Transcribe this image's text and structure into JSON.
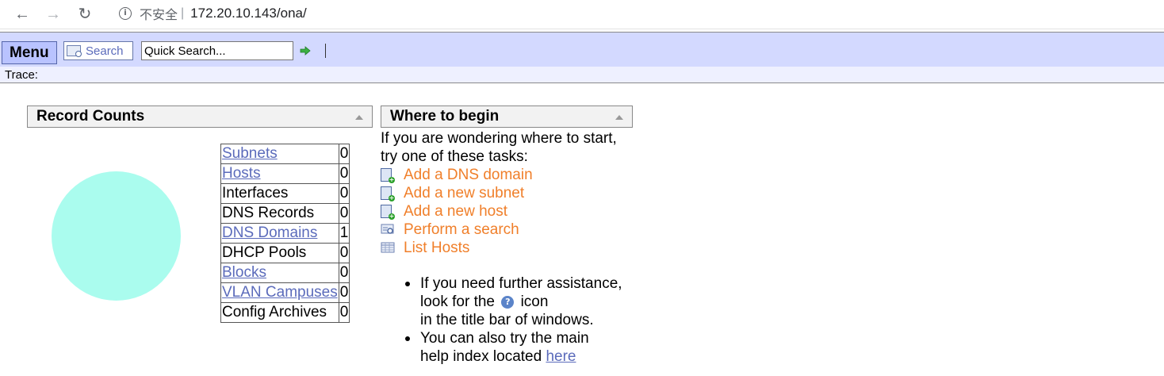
{
  "browser": {
    "back_icon": "arrow-left-icon",
    "forward_icon": "arrow-right-icon",
    "reload_icon": "reload-icon",
    "security_label": "不安全",
    "url": "172.20.10.143/ona/"
  },
  "toolbar": {
    "menu_label": "Menu",
    "search_label": "Search",
    "quick_search_value": "Quick Search...",
    "trace_label": "Trace:"
  },
  "record_counts": {
    "title": "Record Counts",
    "rows": [
      {
        "label": "Subnets",
        "count": "0",
        "link": true
      },
      {
        "label": "Hosts",
        "count": "0",
        "link": true
      },
      {
        "label": "Interfaces",
        "count": "0",
        "link": false
      },
      {
        "label": "DNS Records",
        "count": "0",
        "link": false
      },
      {
        "label": "DNS Domains",
        "count": "1",
        "link": true
      },
      {
        "label": "DHCP Pools",
        "count": "0",
        "link": false
      },
      {
        "label": "Blocks",
        "count": "0",
        "link": true
      },
      {
        "label": "VLAN Campuses",
        "count": "0",
        "link": true
      },
      {
        "label": "Config Archives",
        "count": "0",
        "link": false
      }
    ],
    "pie_color": "#aafcee"
  },
  "where_to_begin": {
    "title": "Where to begin",
    "intro_line1": "If you are wondering where to start,",
    "intro_line2": "try one of these tasks:",
    "tasks": [
      {
        "label": "Add a DNS domain",
        "icon": "add-document-icon"
      },
      {
        "label": "Add a new subnet",
        "icon": "add-document-icon"
      },
      {
        "label": "Add a new host",
        "icon": "add-document-icon"
      },
      {
        "label": "Perform a search",
        "icon": "search-form-icon"
      },
      {
        "label": "List Hosts",
        "icon": "list-grid-icon"
      }
    ],
    "help1_line1": "If you need further assistance,",
    "help1_line2a": "look for the",
    "help1_line2b": "icon",
    "help1_line3": "in the title bar of windows.",
    "help2_line1": "You can also try the main",
    "help2_line2": "help index located",
    "help2_link": "here"
  },
  "colors": {
    "toolbar_bg": "#d3d9ff",
    "link": "#5b6bbb",
    "task_link": "#f07f2a"
  }
}
